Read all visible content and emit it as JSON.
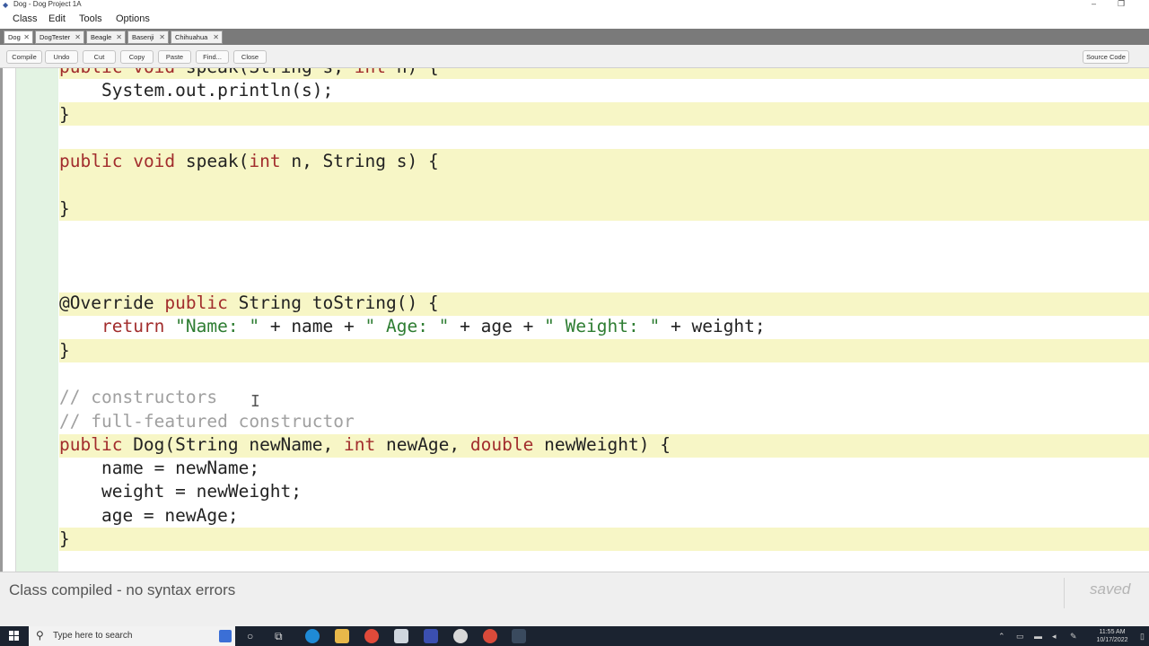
{
  "window": {
    "title": "Dog - Dog Project 1A",
    "minimize_glyph": "–",
    "restore_glyph": "❐"
  },
  "menu": [
    "Class",
    "Edit",
    "Tools",
    "Options"
  ],
  "tabs": [
    {
      "label": "Dog",
      "active": true
    },
    {
      "label": "DogTester",
      "active": false
    },
    {
      "label": "Beagle",
      "active": false
    },
    {
      "label": "Basenji",
      "active": false
    },
    {
      "label": "Chihuahua",
      "active": false
    }
  ],
  "toolbar": {
    "buttons": [
      "Compile",
      "Undo",
      "Cut",
      "Copy",
      "Paste",
      "Find...",
      "Close"
    ],
    "view_mode": "Source Code"
  },
  "code": {
    "lines": [
      {
        "t": "public void speak(String s, int n) {"
      },
      {
        "t": "    System.out.println(s);"
      },
      {
        "t": "}"
      },
      {
        "t": ""
      },
      {
        "t": "public void speak(int n, String s) {"
      },
      {
        "t": ""
      },
      {
        "t": "}"
      },
      {
        "t": ""
      },
      {
        "t": ""
      },
      {
        "t": ""
      },
      {
        "t": "@Override public String toString() {"
      },
      {
        "t": "    return \"Name: \" + name + \" Age: \" + age + \" Weight: \" + weight;"
      },
      {
        "t": "}"
      },
      {
        "t": ""
      },
      {
        "t": "// constructors"
      },
      {
        "t": "// full-featured constructor"
      },
      {
        "t": "public Dog(String newName, int newAge, double newWeight) {"
      },
      {
        "t": "    name = newName;"
      },
      {
        "t": "    weight = newWeight;"
      },
      {
        "t": "    age = newAge;"
      },
      {
        "t": "}"
      }
    ]
  },
  "status": {
    "message": "Class compiled - no syntax errors",
    "saved_label": "saved"
  },
  "taskbar": {
    "search_placeholder": "Type here to search",
    "time": "11:55 AM",
    "date": "10/17/2022"
  },
  "colors": {
    "keyword": "#a22d2d",
    "string": "#2e7d32",
    "comment": "#a0a0a0",
    "method_highlight": "#f7f6c6",
    "gutter": "#e3f3e3"
  }
}
